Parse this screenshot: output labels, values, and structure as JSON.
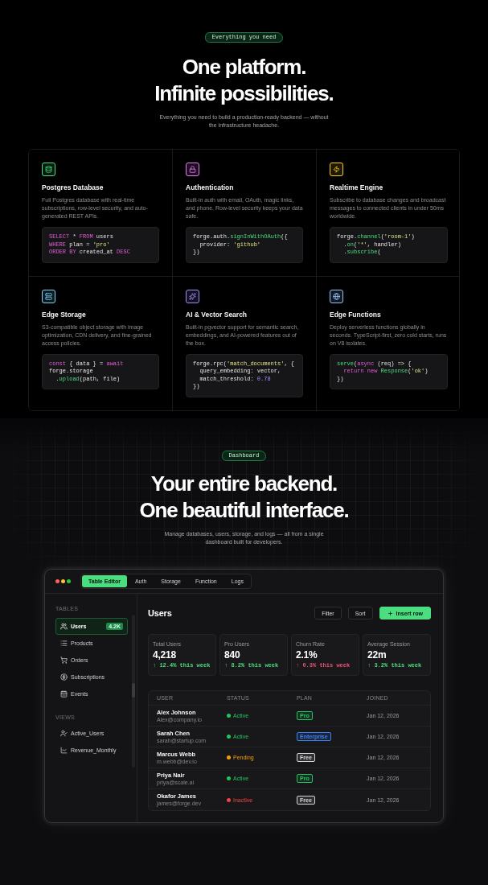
{
  "features_section": {
    "badge": "Everything you need",
    "title_lines": [
      "One platform.",
      "Infinite possibilities."
    ],
    "subtitle": "Everything you need to build a production-ready backend — without the infrastructure headache.",
    "cards": [
      {
        "title": "Postgres Database",
        "color": "#4ade80",
        "description": "Full Postgres database with real-time subscriptions, row-level security, and auto-generated REST APIs.",
        "code": [
          [
            {
              "kind": "keyword",
              "text": "SELECT"
            },
            {
              "kind": "plain",
              "text": " * "
            },
            {
              "kind": "keyword",
              "text": "FROM"
            },
            {
              "kind": "plain",
              "text": " users"
            }
          ],
          [
            {
              "kind": "keyword",
              "text": "WHERE"
            },
            {
              "kind": "plain",
              "text": " plan = "
            },
            {
              "kind": "string",
              "text": "'pro'"
            }
          ],
          [
            {
              "kind": "keyword",
              "text": "ORDER BY"
            },
            {
              "kind": "plain",
              "text": " created_at "
            },
            {
              "kind": "keyword",
              "text": "DESC"
            }
          ]
        ]
      },
      {
        "title": "Authentication",
        "color": "#e879f9",
        "description": "Built-in auth with email, OAuth, magic links, and phone. Row-level security keeps your data safe.",
        "code": [
          [
            {
              "kind": "plain",
              "text": "forge.auth."
            },
            {
              "kind": "function",
              "text": "signInWithOAuth"
            },
            {
              "kind": "plain",
              "text": "({"
            }
          ],
          [
            {
              "kind": "plain",
              "text": "  provider: "
            },
            {
              "kind": "string",
              "text": "'github'"
            }
          ],
          [
            {
              "kind": "plain",
              "text": "})"
            }
          ]
        ]
      },
      {
        "title": "Realtime Engine",
        "color": "#facc15",
        "description": "Subscribe to database changes and broadcast messages to connected clients in under 50ms worldwide.",
        "code": [
          [
            {
              "kind": "plain",
              "text": "forge."
            },
            {
              "kind": "function",
              "text": "channel"
            },
            {
              "kind": "plain",
              "text": "("
            },
            {
              "kind": "string",
              "text": "'room-1'"
            },
            {
              "kind": "plain",
              "text": ")"
            }
          ],
          [
            {
              "kind": "plain",
              "text": "  ."
            },
            {
              "kind": "function",
              "text": "on"
            },
            {
              "kind": "plain",
              "text": "("
            },
            {
              "kind": "string",
              "text": "'*'"
            },
            {
              "kind": "plain",
              "text": ", handler)"
            }
          ],
          [
            {
              "kind": "plain",
              "text": "  ."
            },
            {
              "kind": "function",
              "text": "subscribe"
            },
            {
              "kind": "plain",
              "text": "("
            }
          ]
        ]
      },
      {
        "title": "Edge Storage",
        "color": "#7dd3fc",
        "description": "S3-compatible object storage with image optimization, CDN delivery, and fine-grained access policies.",
        "code": [
          [
            {
              "kind": "keyword",
              "text": "const"
            },
            {
              "kind": "plain",
              "text": " { data } = "
            },
            {
              "kind": "keyword",
              "text": "await"
            }
          ],
          [
            {
              "kind": "plain",
              "text": "forge.storage"
            }
          ],
          [
            {
              "kind": "plain",
              "text": "  ."
            },
            {
              "kind": "function",
              "text": "upload"
            },
            {
              "kind": "plain",
              "text": "(path, file)"
            }
          ]
        ]
      },
      {
        "title": "AI & Vector Search",
        "color": "#a78bfa",
        "description": "Built-in pgvector support for semantic search, embeddings, and AI-powered features out of the box.",
        "code": [
          [
            {
              "kind": "plain",
              "text": "forge.rpc("
            },
            {
              "kind": "string",
              "text": "'match_documents'"
            },
            {
              "kind": "plain",
              "text": ", {"
            }
          ],
          [
            {
              "kind": "plain",
              "text": "  query_embedding: vector,"
            }
          ],
          [
            {
              "kind": "plain",
              "text": "  match_threshold: "
            },
            {
              "kind": "number",
              "text": "0.78"
            }
          ],
          [
            {
              "kind": "plain",
              "text": "})"
            }
          ]
        ]
      },
      {
        "title": "Edge Functions",
        "color": "#93c5fd",
        "description": "Deploy serverless functions globally in seconds. TypeScript-first, zero cold starts, runs on V8 isolates.",
        "code": [
          [
            {
              "kind": "function",
              "text": "serve"
            },
            {
              "kind": "plain",
              "text": "("
            },
            {
              "kind": "keyword",
              "text": "async"
            },
            {
              "kind": "plain",
              "text": " (req) => {"
            }
          ],
          [
            {
              "kind": "keyword",
              "text": "  return new"
            },
            {
              "kind": "function",
              "text": " Response"
            },
            {
              "kind": "plain",
              "text": "("
            },
            {
              "kind": "string",
              "text": "'ok'"
            },
            {
              "kind": "plain",
              "text": ")"
            }
          ],
          [
            {
              "kind": "plain",
              "text": "})"
            }
          ]
        ]
      }
    ]
  },
  "dashboard_section": {
    "badge": "Dashboard",
    "title_lines": [
      "Your entire backend.",
      "One beautiful interface."
    ],
    "subtitle": "Manage databases, users, storage, and logs — all from a single dashboard built for developers."
  },
  "dashboard": {
    "tabs": [
      {
        "label": "Table Editor",
        "selected": true
      },
      {
        "label": "Auth",
        "selected": false
      },
      {
        "label": "Storage",
        "selected": false
      },
      {
        "label": "Function",
        "selected": false
      },
      {
        "label": "Logs",
        "selected": false
      }
    ],
    "sidebar": {
      "sections": [
        {
          "heading": "TABLES",
          "items": [
            {
              "label": "Users",
              "selected": true,
              "badge": "4.2K"
            },
            {
              "label": "Products",
              "selected": false
            },
            {
              "label": "Orders",
              "selected": false
            },
            {
              "label": "Subscriptions",
              "selected": false
            },
            {
              "label": "Events",
              "selected": false
            }
          ]
        },
        {
          "heading": "VIEWS",
          "items": [
            {
              "label": "Active_Users",
              "selected": false
            },
            {
              "label": "Revenue_Monthly",
              "selected": false
            }
          ]
        }
      ]
    },
    "title": "Users",
    "actions": [
      {
        "label": "Filter",
        "kind": "secondary"
      },
      {
        "label": "Sort",
        "kind": "secondary"
      },
      {
        "label": "Insert row",
        "kind": "primary"
      }
    ],
    "stats": [
      {
        "label": "Total Users",
        "value": "4,218",
        "change": "↑ 12.4% this week",
        "color": "#4ade80"
      },
      {
        "label": "Pro Users",
        "value": "840",
        "change": "↑ 8.2% this week",
        "color": "#4ade80"
      },
      {
        "label": "Churn Rate",
        "value": "2.1%",
        "change": "↑ 0.3% this week",
        "color": "#f0506e"
      },
      {
        "label": "Average Session",
        "value": "22m",
        "change": "↑ 3.2% this week",
        "color": "#4ade80"
      }
    ],
    "table": {
      "columns": [
        "USER",
        "STATUS",
        "PLAN",
        "JOINED"
      ],
      "rows": [
        {
          "name": "Alex Johnson",
          "email": "Alex@company.io",
          "status": {
            "label": "Active",
            "color": "#22c55e"
          },
          "plan": {
            "label": "Pro",
            "color": "#22c55e"
          },
          "joined": "Jan 12, 2026"
        },
        {
          "name": "Sarah Chen",
          "email": "sarah@startup.com",
          "status": {
            "label": "Active",
            "color": "#22c55e"
          },
          "plan": {
            "label": "Enterprise",
            "color": "#3b82f6"
          },
          "joined": "Jan 12, 2026"
        },
        {
          "name": "Marcus Webb",
          "email": "m.webb@dev.io",
          "status": {
            "label": "Pending",
            "color": "#f59e0b"
          },
          "plan": {
            "label": "Free",
            "color": "#d4d4d4"
          },
          "joined": "Jan 12, 2026"
        },
        {
          "name": "Priya Nair",
          "email": "priya@scale.ai",
          "status": {
            "label": "Active",
            "color": "#22c55e"
          },
          "plan": {
            "label": "Pro",
            "color": "#22c55e"
          },
          "joined": "Jan 12, 2026"
        },
        {
          "name": "Okafor James",
          "email": "james@forge.dev",
          "status": {
            "label": "Inactive",
            "color": "#ef4444"
          },
          "plan": {
            "label": "Free",
            "color": "#d4d4d4"
          },
          "joined": "Jan 12, 2026"
        }
      ]
    }
  }
}
